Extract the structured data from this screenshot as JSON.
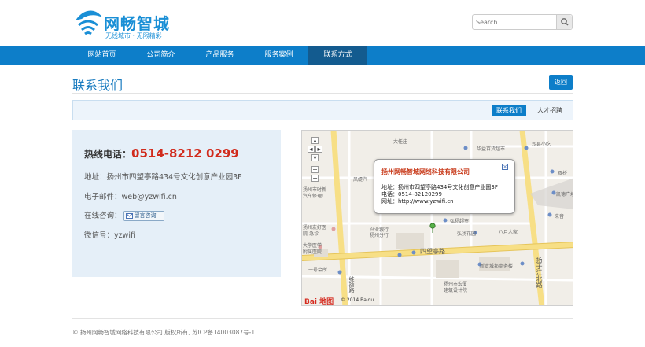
{
  "header": {
    "logo_title": "网畅智城",
    "logo_slogan": "无线城市 · 无限精彩",
    "search_placeholder": "Search..."
  },
  "nav": {
    "items": [
      {
        "label": "网站首页"
      },
      {
        "label": "公司简介"
      },
      {
        "label": "产品服务"
      },
      {
        "label": "服务案例"
      },
      {
        "label": "联系方式"
      }
    ],
    "active_index": 4
  },
  "page": {
    "title": "联系我们",
    "back_label": "返回"
  },
  "subtabs": [
    {
      "label": "联系我们"
    },
    {
      "label": "人才招聘"
    }
  ],
  "contact": {
    "hotline_label": "热线电话：",
    "hotline_number": "0514-8212 0299",
    "address": "地址：扬州市四望亭路434号文化创意产业园3F",
    "email": "电子邮件：web@yzwifi.cn",
    "online_label": "在线咨询：",
    "online_button": "留言咨询",
    "wechat": "微信号：yzwifi"
  },
  "map": {
    "info": {
      "title": "扬州网畅智城网络科技有限公司",
      "address": "地址：扬州市四望亭路434号文化创意产业园3F",
      "phone": "电话：0514-82120299",
      "website": "网址：http://www.yzwifi.cn"
    },
    "labels": {
      "dazhuang": "大任庄",
      "huazhi": "华益百货超市",
      "shapan": "沙县小吃",
      "fengti": "凤缇汽",
      "shuangqiao": "双桥",
      "yangzhou_shizheng": "扬州市时新",
      "qiche": "汽车修理厂",
      "hongyang": "弘扬超市",
      "hongyang_garden": "弘扬花园",
      "bayue": "八月人家",
      "xingye": "兴业银行",
      "xingye2": "扬州分行",
      "yangzhou_youhao": "扬州友好医",
      "yuan_jizhen": "院-急诊",
      "daxue": "大学医学",
      "daxue2": "附属医院",
      "kaide": "凯德广场",
      "laiyin": "来音",
      "xinfang": "新贵城邦商务楼",
      "yihuiguan": "一号会所",
      "hongyi": "扬州市宏厦",
      "hongyi2": "建筑设计院",
      "weiyang": "维扬路",
      "yangzi": "扬子江北路",
      "siwangting": "四望亭路"
    },
    "copyright": "© 2014 Baidu",
    "baidu_logo": "Bai 地图"
  },
  "footer": {
    "text": "© 扬州网畅智城网络科技有限公司 版权所有, 苏ICP备14003087号-1"
  },
  "colors": {
    "brand_blue": "#0d7ec9",
    "nav_active": "#135b8f",
    "hotline_red": "#d12b1d",
    "panel_bg": "#e5eff8"
  }
}
